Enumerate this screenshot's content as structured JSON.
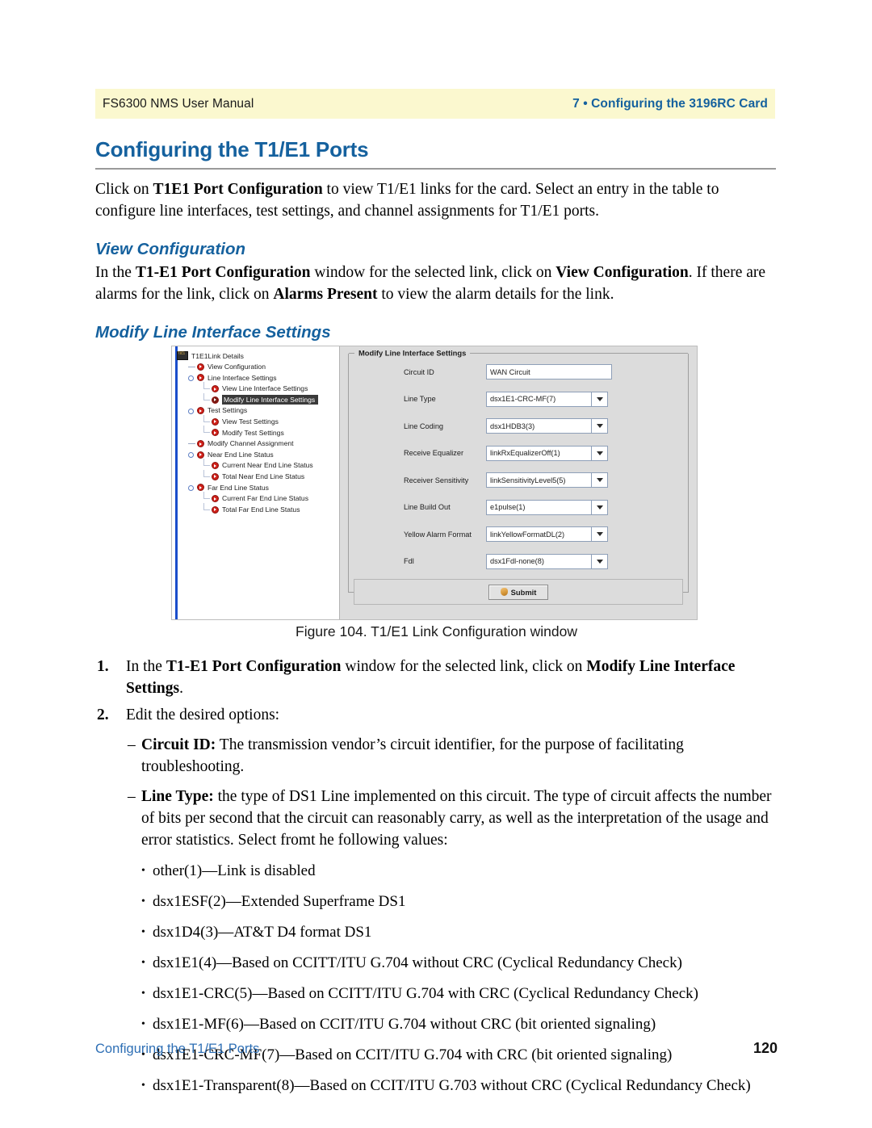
{
  "header": {
    "left": "FS6300 NMS User Manual",
    "right": "7 • Configuring the 3196RC Card"
  },
  "title": "Configuring the T1/E1 Ports",
  "intro": {
    "a": "Click on ",
    "b1": "T1E1 Port Configuration",
    "c": " to view T1/E1 links for the card. Select an entry in the table to configure line interfaces, test settings, and channel assignments for T1/E1 ports."
  },
  "section_view": {
    "heading": "View Configuration",
    "a": "In the ",
    "b1": "T1-E1 Port Configuration",
    "c": " window for the selected link, click on ",
    "b2": "View Configuration",
    "d": ". If there are alarms for the link, click on ",
    "b3": "Alarms Present",
    "e": " to view the alarm details for the link."
  },
  "section_modify": {
    "heading": "Modify Line Interface Settings"
  },
  "app": {
    "tree": {
      "root": {
        "label": "T1E1Link Details",
        "icon": "t1e1-badge-icon"
      },
      "nodes": [
        {
          "label": "View Configuration",
          "level": 1,
          "handle": "plusline",
          "selected": false
        },
        {
          "label": "Line Interface Settings",
          "level": 1,
          "handle": "knob",
          "selected": false
        },
        {
          "label": "View Line Interface Settings",
          "level": 2,
          "handle": "elbow",
          "selected": false
        },
        {
          "label": "Modify Line Interface Settings",
          "level": 2,
          "handle": "elbow",
          "selected": true
        },
        {
          "label": "Test Settings",
          "level": 1,
          "handle": "knob",
          "selected": false
        },
        {
          "label": "View Test Settings",
          "level": 2,
          "handle": "elbow",
          "selected": false
        },
        {
          "label": "Modify Test Settings",
          "level": 2,
          "handle": "elbow",
          "selected": false
        },
        {
          "label": "Modify Channel Assignment",
          "level": 1,
          "handle": "plusline",
          "selected": false
        },
        {
          "label": "Near End Line Status",
          "level": 1,
          "handle": "knob",
          "selected": false
        },
        {
          "label": "Current Near End Line Status",
          "level": 2,
          "handle": "elbow",
          "selected": false
        },
        {
          "label": "Total Near End Line Status",
          "level": 2,
          "handle": "elbow",
          "selected": false
        },
        {
          "label": "Far End Line Status",
          "level": 1,
          "handle": "knob",
          "selected": false
        },
        {
          "label": "Current Far End Line Status",
          "level": 2,
          "handle": "elbow",
          "selected": false
        },
        {
          "label": "Total Far End Line Status",
          "level": 2,
          "handle": "elbow",
          "selected": false
        }
      ]
    },
    "form": {
      "group_label": "Modify Line Interface Settings",
      "fields": [
        {
          "label": "Circuit ID",
          "value": "WAN Circuit",
          "type": "text"
        },
        {
          "label": "Line Type",
          "value": "dsx1E1-CRC-MF(7)",
          "type": "combo"
        },
        {
          "label": "Line Coding",
          "value": "dsx1HDB3(3)",
          "type": "combo"
        },
        {
          "label": "Receive Equalizer",
          "value": "linkRxEqualizerOff(1)",
          "type": "combo"
        },
        {
          "label": "Receiver Sensitivity",
          "value": "linkSensitivityLevel5(5)",
          "type": "combo"
        },
        {
          "label": "Line Build Out",
          "value": "e1pulse(1)",
          "type": "combo"
        },
        {
          "label": "Yellow Alarm Format",
          "value": "linkYellowFormatDL(2)",
          "type": "combo"
        },
        {
          "label": "Fdl",
          "value": "dsx1Fdl-none(8)",
          "type": "combo"
        }
      ],
      "submit_label": "Submit"
    }
  },
  "figure_caption": "Figure 104. T1/E1 Link Configuration window",
  "steps": [
    {
      "num": "1.",
      "a": "In the ",
      "b1": "T1-E1 Port Configuration",
      "c": " window for the selected link, click on ",
      "b2": "Modify Line Interface Settings",
      "d": "."
    },
    {
      "num": "2.",
      "a": "Edit the desired options:",
      "b1": "",
      "c": "",
      "b2": "",
      "d": ""
    }
  ],
  "definitions": [
    {
      "mark": "–",
      "term": "Circuit ID:",
      "text": " The transmission vendor’s circuit identifier, for the purpose of facilitating troubleshooting."
    },
    {
      "mark": "–",
      "term": "Line Type:",
      "text": " the type of DS1 Line implemented on this circuit. The type of circuit affects the number of bits per second that the circuit can reasonably carry, as well as the interpretation of the usage and error statistics. Select fromt he following values:"
    }
  ],
  "line_type_values": [
    {
      "mark": "•",
      "text": "other(1)—Link is disabled"
    },
    {
      "mark": "•",
      "text": "dsx1ESF(2)—Extended Superframe DS1"
    },
    {
      "mark": "•",
      "text": "dsx1D4(3)—AT&T D4 format DS1"
    },
    {
      "mark": "•",
      "text": "dsx1E1(4)—Based on CCITT/ITU G.704 without CRC (Cyclical Redundancy Check)"
    },
    {
      "mark": "•",
      "text": "dsx1E1-CRC(5)—Based on CCITT/ITU G.704 with CRC (Cyclical Redundancy Check)"
    },
    {
      "mark": "•",
      "text": "dsx1E1-MF(6)—Based on CCIT/ITU G.704 without CRC (bit oriented signaling)"
    },
    {
      "mark": "•",
      "text": "dsx1E1-CRC-MF(7)—Based on CCIT/ITU G.704 with CRC (bit oriented signaling)"
    },
    {
      "mark": "•",
      "text": "dsx1E1-Transparent(8)—Based on CCIT/ITU G.703 without CRC (Cyclical Redundancy Check)"
    }
  ],
  "footer": {
    "left": "Configuring the T1/E1 Ports",
    "right": "120"
  }
}
